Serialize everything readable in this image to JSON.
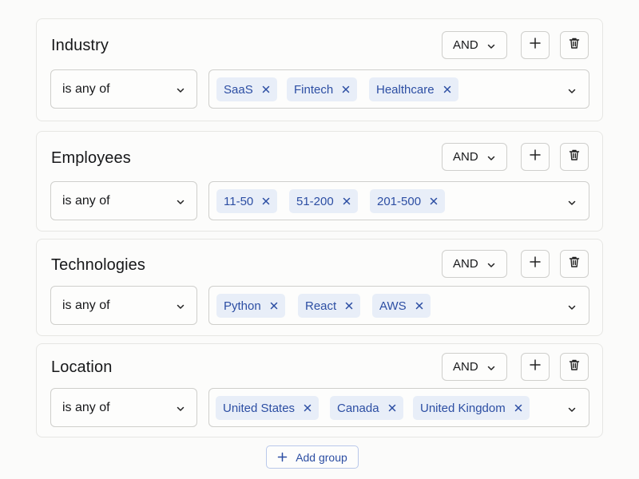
{
  "groups": [
    {
      "title": "Industry",
      "logic": "AND",
      "operator": "is any of",
      "chips": [
        "SaaS",
        "Fintech",
        "Healthcare"
      ]
    },
    {
      "title": "Employees",
      "logic": "AND",
      "operator": "is any of",
      "chips": [
        "11-50",
        "51-200",
        "201-500"
      ]
    },
    {
      "title": "Technologies",
      "logic": "AND",
      "operator": "is any of",
      "chips": [
        "Python",
        "React",
        "AWS"
      ]
    },
    {
      "title": "Location",
      "logic": "AND",
      "operator": "is any of",
      "chips": [
        "United States",
        "Canada",
        "United Kingdom"
      ]
    }
  ],
  "add_group_label": "Add group",
  "icons": {
    "chevron": "chevron-down-icon",
    "add": "plus-icon",
    "delete": "trash-icon",
    "remove": "close-icon"
  },
  "colors": {
    "accent": "#2c4ea3",
    "chip_bg": "#e8eef8"
  }
}
